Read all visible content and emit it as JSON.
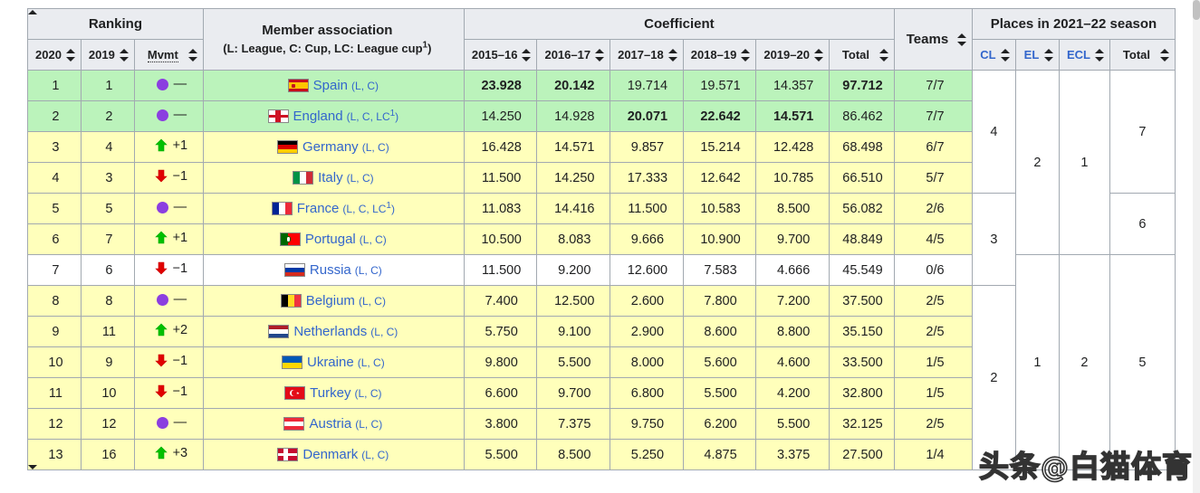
{
  "header": {
    "groups": {
      "ranking": "Ranking",
      "member_association": "Member association",
      "member_association_sub_prefix": "(L: League, C: Cup, LC: League cup",
      "member_association_sub_note": "1",
      "member_association_sub_suffix": ")",
      "coefficient": "Coefficient",
      "places": "Places in 2021–22 season"
    },
    "columns": {
      "y2020": "2020",
      "y2019": "2019",
      "mvmt": "Mvmt",
      "c1": "2015–16",
      "c2": "2016–17",
      "c3": "2017–18",
      "c4": "2018–19",
      "c5": "2019–20",
      "total": "Total",
      "teams": "Teams",
      "cl": "CL",
      "el": "EL",
      "ecl": "ECL",
      "places_total": "Total"
    }
  },
  "rows": [
    {
      "tint": "green",
      "rank2020": "1",
      "rank2019": "1",
      "mvmt_dir": "same",
      "mvmt_label": "—",
      "flag": "spain",
      "country": "Spain",
      "comps": "(L, C)",
      "coeffs": [
        "23.928",
        "20.142",
        "19.714",
        "19.571",
        "14.357"
      ],
      "coeffs_bold": [
        true,
        true,
        false,
        false,
        false
      ],
      "total": "97.712",
      "total_bold": true,
      "teams": "7/7"
    },
    {
      "tint": "green",
      "rank2020": "2",
      "rank2019": "2",
      "mvmt_dir": "same",
      "mvmt_label": "—",
      "flag": "england",
      "country": "England",
      "comps": "(L, C, LC1)",
      "comps_sup": "1",
      "comps_pre": "(L, C, LC",
      "comps_post": ")",
      "coeffs": [
        "14.250",
        "14.928",
        "20.071",
        "22.642",
        "14.571"
      ],
      "coeffs_bold": [
        false,
        false,
        true,
        true,
        true
      ],
      "total": "86.462",
      "total_bold": false,
      "teams": "7/7"
    },
    {
      "tint": "yellow",
      "rank2020": "3",
      "rank2019": "4",
      "mvmt_dir": "up",
      "mvmt_label": "+1",
      "flag": "germany",
      "country": "Germany",
      "comps": "(L, C)",
      "coeffs": [
        "16.428",
        "14.571",
        "9.857",
        "15.214",
        "12.428"
      ],
      "coeffs_bold": [
        false,
        false,
        false,
        false,
        false
      ],
      "total": "68.498",
      "total_bold": false,
      "teams": "6/7"
    },
    {
      "tint": "yellow",
      "rank2020": "4",
      "rank2019": "3",
      "mvmt_dir": "down",
      "mvmt_label": "−1",
      "flag": "italy",
      "country": "Italy",
      "comps": "(L, C)",
      "coeffs": [
        "11.500",
        "14.250",
        "17.333",
        "12.642",
        "10.785"
      ],
      "coeffs_bold": [
        false,
        false,
        false,
        false,
        false
      ],
      "total": "66.510",
      "total_bold": false,
      "teams": "5/7"
    },
    {
      "tint": "yellow",
      "rank2020": "5",
      "rank2019": "5",
      "mvmt_dir": "same",
      "mvmt_label": "—",
      "flag": "france",
      "country": "France",
      "comps": "(L, C, LC1)",
      "comps_sup": "1",
      "comps_pre": "(L, C, LC",
      "comps_post": ")",
      "coeffs": [
        "11.083",
        "14.416",
        "11.500",
        "10.583",
        "8.500"
      ],
      "coeffs_bold": [
        false,
        false,
        false,
        false,
        false
      ],
      "total": "56.082",
      "total_bold": false,
      "teams": "2/6"
    },
    {
      "tint": "yellow",
      "rank2020": "6",
      "rank2019": "7",
      "mvmt_dir": "up",
      "mvmt_label": "+1",
      "flag": "portugal",
      "country": "Portugal",
      "comps": "(L, C)",
      "coeffs": [
        "10.500",
        "8.083",
        "9.666",
        "10.900",
        "9.700"
      ],
      "coeffs_bold": [
        false,
        false,
        false,
        false,
        false
      ],
      "total": "48.849",
      "total_bold": false,
      "teams": "4/5"
    },
    {
      "tint": "white",
      "rank2020": "7",
      "rank2019": "6",
      "mvmt_dir": "down",
      "mvmt_label": "−1",
      "flag": "russia",
      "country": "Russia",
      "comps": "(L, C)",
      "coeffs": [
        "11.500",
        "9.200",
        "12.600",
        "7.583",
        "4.666"
      ],
      "coeffs_bold": [
        false,
        false,
        false,
        false,
        false
      ],
      "total": "45.549",
      "total_bold": false,
      "teams": "0/6"
    },
    {
      "tint": "yellow",
      "rank2020": "8",
      "rank2019": "8",
      "mvmt_dir": "same",
      "mvmt_label": "—",
      "flag": "belgium",
      "country": "Belgium",
      "comps": "(L, C)",
      "coeffs": [
        "7.400",
        "12.500",
        "2.600",
        "7.800",
        "7.200"
      ],
      "coeffs_bold": [
        false,
        false,
        false,
        false,
        false
      ],
      "total": "37.500",
      "total_bold": false,
      "teams": "2/5"
    },
    {
      "tint": "yellow",
      "rank2020": "9",
      "rank2019": "11",
      "mvmt_dir": "up",
      "mvmt_label": "+2",
      "flag": "netherlands",
      "country": "Netherlands",
      "comps": "(L, C)",
      "coeffs": [
        "5.750",
        "9.100",
        "2.900",
        "8.600",
        "8.800"
      ],
      "coeffs_bold": [
        false,
        false,
        false,
        false,
        false
      ],
      "total": "35.150",
      "total_bold": false,
      "teams": "2/5"
    },
    {
      "tint": "yellow",
      "rank2020": "10",
      "rank2019": "9",
      "mvmt_dir": "down",
      "mvmt_label": "−1",
      "flag": "ukraine",
      "country": "Ukraine",
      "comps": "(L, C)",
      "coeffs": [
        "9.800",
        "5.500",
        "8.000",
        "5.600",
        "4.600"
      ],
      "coeffs_bold": [
        false,
        false,
        false,
        false,
        false
      ],
      "total": "33.500",
      "total_bold": false,
      "teams": "1/5"
    },
    {
      "tint": "yellow",
      "rank2020": "11",
      "rank2019": "10",
      "mvmt_dir": "down",
      "mvmt_label": "−1",
      "flag": "turkey",
      "country": "Turkey",
      "comps": "(L, C)",
      "coeffs": [
        "6.600",
        "9.700",
        "6.800",
        "5.500",
        "4.200"
      ],
      "coeffs_bold": [
        false,
        false,
        false,
        false,
        false
      ],
      "total": "32.800",
      "total_bold": false,
      "teams": "1/5"
    },
    {
      "tint": "yellow",
      "rank2020": "12",
      "rank2019": "12",
      "mvmt_dir": "same",
      "mvmt_label": "—",
      "flag": "austria",
      "country": "Austria",
      "comps": "(L, C)",
      "coeffs": [
        "3.800",
        "7.375",
        "9.750",
        "6.200",
        "5.500"
      ],
      "coeffs_bold": [
        false,
        false,
        false,
        false,
        false
      ],
      "total": "32.125",
      "total_bold": false,
      "teams": "2/5"
    },
    {
      "tint": "yellow",
      "rank2020": "13",
      "rank2019": "16",
      "mvmt_dir": "up",
      "mvmt_label": "+3",
      "flag": "denmark",
      "country": "Denmark",
      "comps": "(L, C)",
      "coeffs": [
        "5.500",
        "8.500",
        "5.250",
        "4.875",
        "3.375"
      ],
      "coeffs_bold": [
        false,
        false,
        false,
        false,
        false
      ],
      "total": "27.500",
      "total_bold": false,
      "teams": "1/4"
    }
  ],
  "places": {
    "cl": [
      {
        "value": "4",
        "rowspan": 4
      },
      {
        "value": "3",
        "rowspan": 3
      },
      {
        "value": "2",
        "rowspan": 6
      }
    ],
    "el": [
      {
        "value": "2",
        "rowspan": 6
      },
      {
        "value": "1",
        "rowspan": 7
      }
    ],
    "ecl": [
      {
        "value": "1",
        "rowspan": 6
      },
      {
        "value": "2",
        "rowspan": 7
      }
    ],
    "total": [
      {
        "value": "7",
        "rowspan": 4
      },
      {
        "value": "6",
        "rowspan": 2
      },
      {
        "value": "5",
        "rowspan": 7
      }
    ]
  },
  "watermark": {
    "prefix": "头条",
    "at": "@",
    "handle": "白猫体育"
  },
  "colors": {
    "link": "#3366cc",
    "tint_green": "#bbf3bb",
    "tint_yellow": "#ffffbb",
    "header_bg": "#eaecf0",
    "border": "#a2a9b1",
    "up_arrow": "#00c000",
    "down_arrow": "#e00000",
    "same_dot": "#8b3ee0"
  }
}
